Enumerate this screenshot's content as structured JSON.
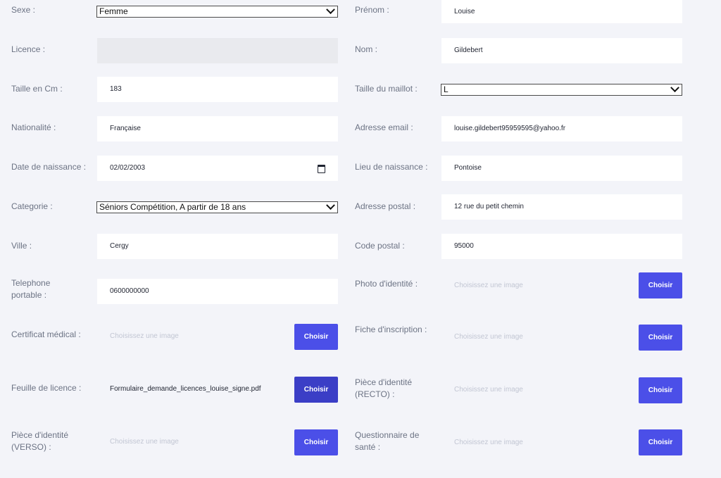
{
  "form": {
    "sexe": {
      "label": "Sexe :",
      "value": "Femme"
    },
    "prenom": {
      "label": "Prénom :",
      "value": "Louise"
    },
    "licence": {
      "label": "Licence :",
      "value": ""
    },
    "nom": {
      "label": "Nom :",
      "value": "Gildebert"
    },
    "taille": {
      "label": "Taille en Cm :",
      "value": "183"
    },
    "maillot": {
      "label": "Taille du maillot :",
      "value": "L"
    },
    "nationalite": {
      "label": "Nationalité :",
      "value": "Française"
    },
    "email": {
      "label": "Adresse email :",
      "value": "louise.gildebert95959595@yahoo.fr"
    },
    "naissance": {
      "label": "Date de naissance :",
      "value": "02/02/2003"
    },
    "lieu": {
      "label": "Lieu de naissance :",
      "value": "Pontoise"
    },
    "categorie": {
      "label": "Categorie :",
      "value": "Séniors Compétition, A partir de 18 ans"
    },
    "adresse": {
      "label": "Adresse postal :",
      "value": "12 rue du petit chemin"
    },
    "ville": {
      "label": "Ville :",
      "value": "Cergy"
    },
    "cp": {
      "label": "Code postal :",
      "value": "95000"
    },
    "telephone": {
      "label": "Telephone portable :",
      "value": "0600000000"
    },
    "photo": {
      "label": "Photo d'identité :",
      "placeholder": "Choisissez une image"
    },
    "certificat": {
      "label": "Certificat médical :",
      "placeholder": "Choisissez une image"
    },
    "fiche": {
      "label": "Fiche d'inscription :",
      "placeholder": "Choisissez une image"
    },
    "feuille": {
      "label": "Feuille de licence :",
      "value": "Formulaire_demande_licences_louise_signe.pdf"
    },
    "recto": {
      "label": "Pièce d'identité (RECTO) :",
      "placeholder": "Choisissez une image"
    },
    "verso": {
      "label": "Pièce d'identité (VERSO) :",
      "placeholder": "Choisissez une image"
    },
    "questionnaire": {
      "label": "Questionnaire de santé :",
      "placeholder": "Choisissez une image"
    },
    "button_label": "Choisir"
  },
  "colors": {
    "button": "#4b4fe8",
    "button_active": "#3b3ec6",
    "background": "#f3f4f9"
  }
}
